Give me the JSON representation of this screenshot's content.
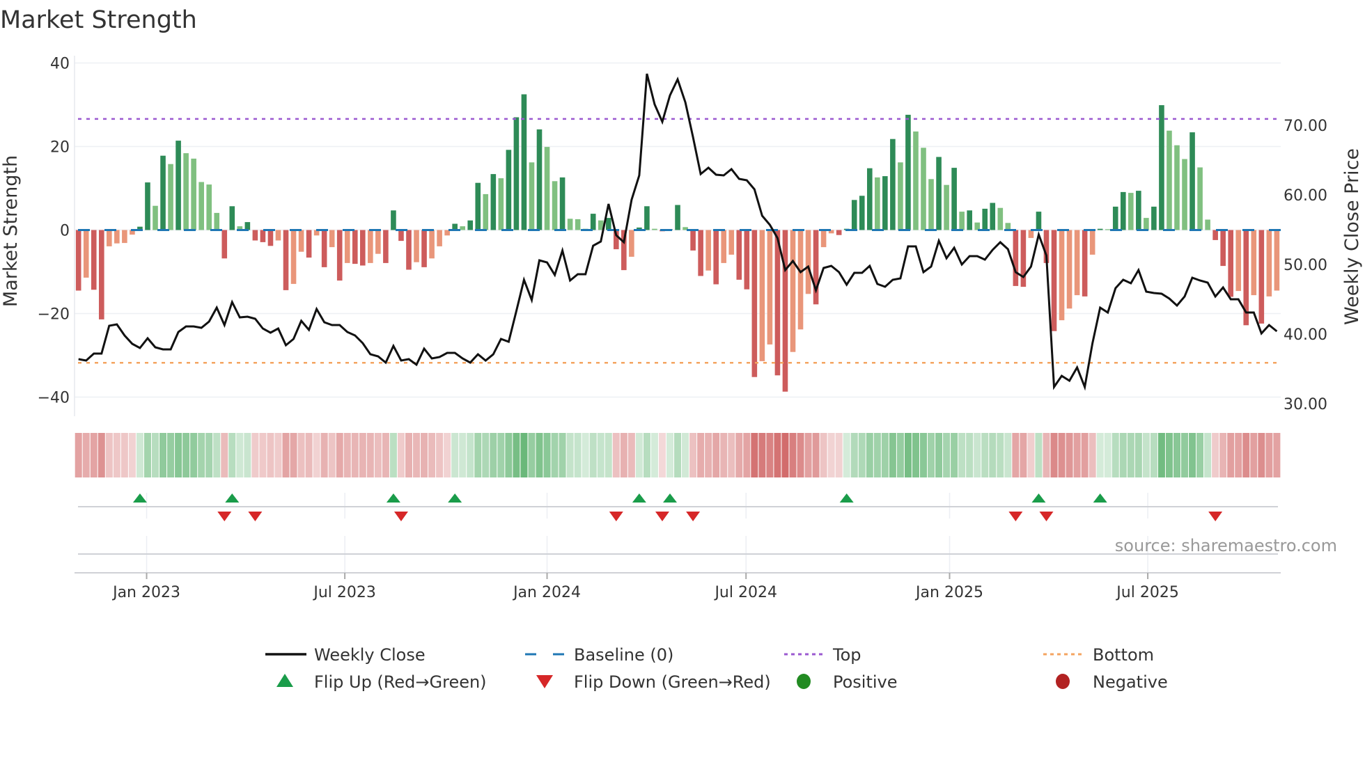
{
  "title": "Market Strength",
  "source": "source: sharemaestro.com",
  "chart_data": {
    "type": "bar",
    "title": "Market Strength",
    "ylabel": "Market Strength",
    "y2label": "Weekly Close Price",
    "ylim": [
      -40,
      40
    ],
    "y2lim": [
      30,
      70
    ],
    "yticks": [
      "40",
      "20",
      "0",
      "−20",
      "−40"
    ],
    "ytick_values": [
      40,
      20,
      0,
      -20,
      -40
    ],
    "y2ticks": [
      "70.00",
      "60.00",
      "50.00",
      "40.00",
      "30.00"
    ],
    "y2tick_values": [
      70,
      60,
      50,
      40,
      30
    ],
    "xticks": [
      {
        "label": "Jan 2023",
        "week": 8.87
      },
      {
        "label": "Jul 2023",
        "week": 34.67
      },
      {
        "label": "Jan 2024",
        "week": 61.0
      },
      {
        "label": "Jul 2024",
        "week": 86.9
      },
      {
        "label": "Jan 2025",
        "week": 113.4
      },
      {
        "label": "Jul 2025",
        "week": 139.2
      }
    ],
    "top_level": 26.6,
    "bottom_level": -31.8,
    "baseline": 0,
    "strength": [
      -14.5,
      -11.4,
      -14.3,
      -21.4,
      -3.9,
      -3.2,
      -3.1,
      -1.1,
      0.8,
      11.4,
      5.8,
      17.8,
      15.8,
      21.4,
      18.4,
      17.1,
      11.5,
      10.9,
      4.1,
      -6.8,
      5.7,
      0.9,
      1.9,
      -2.5,
      -2.9,
      -3.8,
      -2.5,
      -14.4,
      -12.9,
      -5.2,
      -6.6,
      -1.3,
      -8.9,
      -4.1,
      -12.1,
      -7.9,
      -8.1,
      -8.5,
      -7.9,
      -5.7,
      -7.9,
      4.7,
      -2.6,
      -9.5,
      -7.7,
      -8.9,
      -6.8,
      -3.9,
      -1.3,
      1.5,
      0.9,
      2.3,
      11.3,
      8.6,
      13.4,
      12.4,
      19.2,
      27,
      32.5,
      16.2,
      24.1,
      19.9,
      11.7,
      12.6,
      2.7,
      2.6,
      0.3,
      3.9,
      2.3,
      2.9,
      -4.6,
      -9.6,
      -6.4,
      0.6,
      5.7,
      0.3,
      -0.3,
      0.2,
      6,
      0.7,
      -4.9,
      -11,
      -9.7,
      -13,
      -7.9,
      -5.9,
      -11.9,
      -14.2,
      -35.2,
      -31.4,
      -27.4,
      -34.8,
      -38.7,
      -29.2,
      -23.8,
      -15.3,
      -17.8,
      -4.1,
      -0.8,
      -1.2,
      0.3,
      7.2,
      8.2,
      14.8,
      12.6,
      12.9,
      21.8,
      16.2,
      27.6,
      23.6,
      19.7,
      12.2,
      17.5,
      10.8,
      14.9,
      4.4,
      4.7,
      1.8,
      5.1,
      6.5,
      5.3,
      1.7,
      -13.4,
      -13.6,
      -1.9,
      4.4,
      -7.9,
      -24.2,
      -21.6,
      -18.8,
      -15.6,
      -15.9,
      -5.9,
      0.3,
      0.2,
      5.6,
      9.1,
      8.9,
      9.4,
      2.9,
      5.6,
      29.9,
      23.8,
      20.3,
      17,
      23.4,
      15,
      2.5,
      -2.4,
      -8.6,
      -16,
      -14.6,
      -22.8,
      -15.6,
      -22.4,
      -15.9,
      -14.5
    ],
    "weekly_close": [
      36.4,
      36.2,
      37.2,
      37.2,
      41.2,
      41.4,
      39.8,
      38.6,
      38,
      39.4,
      38.1,
      37.8,
      37.8,
      40.3,
      41.1,
      41.1,
      40.9,
      41.8,
      43.8,
      41.3,
      44.6,
      42.4,
      42.5,
      42.2,
      40.8,
      40.2,
      40.8,
      38.4,
      39.3,
      41.9,
      40.6,
      43.6,
      41.7,
      41.3,
      41.3,
      40.3,
      39.8,
      38.7,
      37.1,
      36.8,
      35.9,
      38.3,
      36.2,
      36.4,
      35.6,
      37.9,
      36.5,
      36.7,
      37.3,
      37.3,
      36.5,
      35.9,
      37.1,
      36.2,
      37.1,
      39.3,
      38.9,
      43.3,
      47.8,
      44.9,
      50.6,
      50.3,
      48.5,
      52,
      47.7,
      48.6,
      48.6,
      52.7,
      53.3,
      58.7,
      54.2,
      53.2,
      59.3,
      62.8,
      77.4,
      73,
      70.5,
      74.3,
      76.6,
      73.3,
      68.3,
      63,
      63.9,
      62.9,
      62.8,
      63.7,
      62.3,
      62.1,
      60.8,
      57,
      55.7,
      53.8,
      49.2,
      50.5,
      48.9,
      49.7,
      46.3,
      49.5,
      49.8,
      48.9,
      47.1,
      48.8,
      48.8,
      49.8,
      47.2,
      46.8,
      47.8,
      48,
      52.6,
      52.6,
      48.9,
      49.7,
      53.4,
      50.9,
      52.4,
      50,
      51.2,
      51.2,
      50.7,
      52.1,
      53.2,
      52.2,
      48.9,
      48.2,
      49.7,
      54.3,
      51.3,
      32.4,
      34,
      33.3,
      35.2,
      32.4,
      38.7,
      43.8,
      43.1,
      46.6,
      47.8,
      47.3,
      49.2,
      46.1,
      45.9,
      45.8,
      45.1,
      44.1,
      45.4,
      48.1,
      47.7,
      47.4,
      45.4,
      46.7,
      45,
      45,
      43.1,
      43.1,
      40.1,
      41.3,
      40.4
    ],
    "legend": {
      "placement": "bottom",
      "items": [
        {
          "label": "Weekly Close",
          "symbol": "line",
          "color": "#111111"
        },
        {
          "label": "Baseline (0)",
          "symbol": "dash",
          "color": "#1f77b4"
        },
        {
          "label": "Top",
          "symbol": "dot",
          "color": "#9b59d0"
        },
        {
          "label": "Bottom",
          "symbol": "dot",
          "color": "#f4a460"
        },
        {
          "label": "Flip Up (Red→Green)",
          "symbol": "triangle-up",
          "color": "#1a9c4a"
        },
        {
          "label": "Flip Down (Green→Red)",
          "symbol": "triangle-down",
          "color": "#d62728"
        },
        {
          "label": "Positive",
          "symbol": "circle",
          "color": "#228b22"
        },
        {
          "label": "Negative",
          "symbol": "circle",
          "color": "#b22222"
        }
      ]
    },
    "colors": {
      "pos_strong": "#2e8b57",
      "pos_weak": "#80c080",
      "neg_strong": "#cd5c5c",
      "neg_weak": "#e9967a",
      "flip_up": "#1a9c4a",
      "flip_down": "#d62728",
      "top": "#9b59d0",
      "bottom": "#f4a460",
      "baseline": "#1f77b4"
    }
  }
}
